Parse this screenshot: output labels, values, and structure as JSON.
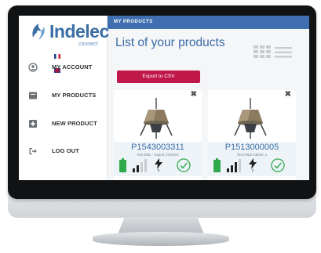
{
  "brand": {
    "name": "Indelec",
    "subtitle": "connect",
    "colors": {
      "primary": "#3a6ea5",
      "accent": "#c0174a",
      "status_green": "#2eaa4d"
    }
  },
  "language_flags": [
    "flag-fr-icon",
    "flag-uk-icon"
  ],
  "sidebar": {
    "items": [
      {
        "label": "MY ACCOUNT",
        "icon": "account-icon"
      },
      {
        "label": "MY PRODUCTS",
        "icon": "products-icon"
      },
      {
        "label": "NEW PRODUCT",
        "icon": "add-icon"
      },
      {
        "label": "LOG OUT",
        "icon": "logout-icon"
      }
    ]
  },
  "topbar": {
    "title": "MY PRODUCTS"
  },
  "main": {
    "title": "List of your products",
    "export_label": "Export to CSV",
    "view_icons": [
      "grid-view-icon",
      "list-view-icon"
    ]
  },
  "products": [
    {
      "id": "P1543003311",
      "description": "Test Bitts - Export CONGO",
      "strikes": "0"
    },
    {
      "id": "P1513000005",
      "description": "Test R&D Indelec 1",
      "strikes": "2"
    }
  ]
}
